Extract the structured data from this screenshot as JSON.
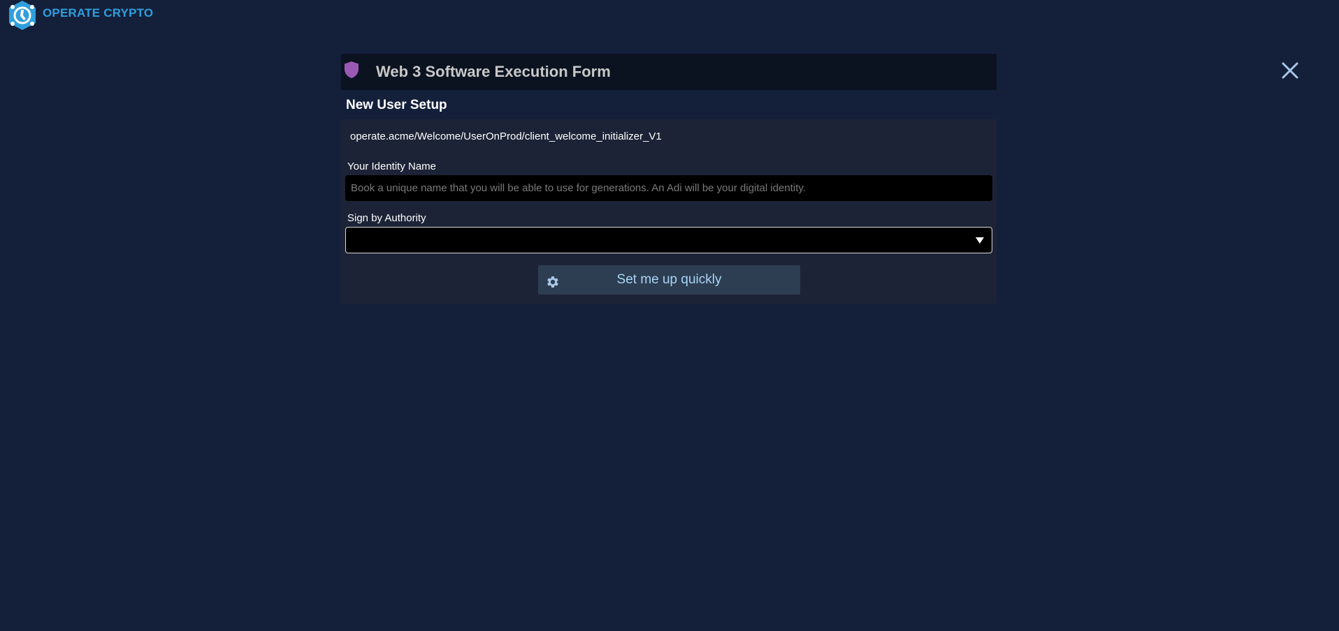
{
  "brand": {
    "name": "OPERATE CRYPTO",
    "color": "#2f9fdc"
  },
  "modal": {
    "title": "Web 3 Software Execution Form",
    "title_icon": "shield-icon",
    "shield_color": "#9b59b6",
    "close_icon": "close-icon"
  },
  "form": {
    "section_title": "New User Setup",
    "path": "operate.acme/Welcome/UserOnProd/client_welcome_initializer_V1",
    "identity_label": "Your Identity Name",
    "identity_placeholder": "Book a unique name that you will be able to use for generations. An Adi will be your digital identity.",
    "identity_value": "",
    "authority_label": "Sign by Authority",
    "authority_selected": "",
    "submit_label": "Set me up quickly",
    "submit_icon": "gear-icon"
  }
}
